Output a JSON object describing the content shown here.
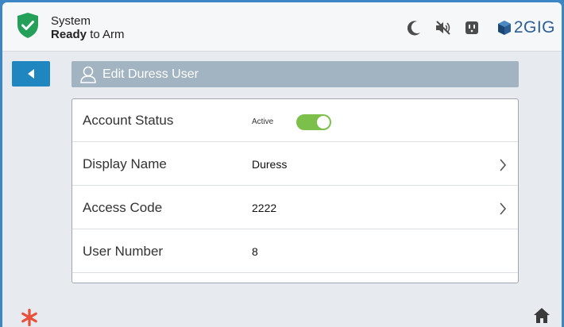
{
  "status": {
    "line1": "System",
    "line2_bold": "Ready",
    "line2_rest": " to Arm",
    "shield_color": "#25a05b"
  },
  "header_icons": [
    "moon-icon",
    "muted-speaker-icon",
    "outlet-icon"
  ],
  "brand": {
    "text": "2GIG",
    "color": "#2b5e95"
  },
  "page": {
    "title": "Edit Duress User"
  },
  "rows": [
    {
      "label": "Account Status",
      "value": "Active",
      "toggle_on": true
    },
    {
      "label": "Display Name",
      "value": "Duress"
    },
    {
      "label": "Access Code",
      "value": "2222"
    },
    {
      "label": "User Number",
      "value": "8"
    }
  ],
  "colors": {
    "accent": "#1f86bf",
    "toggle_on": "#7cc04b",
    "star": "#e8503a",
    "frame_border": "#3d86c6"
  }
}
